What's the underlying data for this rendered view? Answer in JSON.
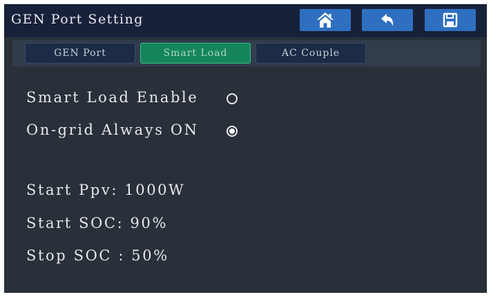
{
  "header": {
    "title": "GEN Port Setting",
    "buttons": [
      {
        "icon": "home-icon"
      },
      {
        "icon": "back-arrow-icon"
      },
      {
        "icon": "save-icon"
      }
    ]
  },
  "tabs": [
    {
      "label": "GEN Port",
      "active": false
    },
    {
      "label": "Smart Load",
      "active": true
    },
    {
      "label": "AC Couple",
      "active": false
    }
  ],
  "settings": {
    "smart_load_enable": {
      "label": "Smart Load Enable",
      "checked": false
    },
    "on_grid_always_on": {
      "label": "On-grid Always ON",
      "checked": true
    }
  },
  "values": {
    "start_ppv": "Start Ppv: 1000W",
    "start_soc": "Start SOC: 90%",
    "stop_soc": "Stop SOC : 50%"
  },
  "colors": {
    "background": "#293039",
    "header": "#18213a",
    "button": "#2f6fc0",
    "tab": "#1c2b46",
    "active_tab": "#16855a",
    "active_tab_border": "#38c48a"
  }
}
